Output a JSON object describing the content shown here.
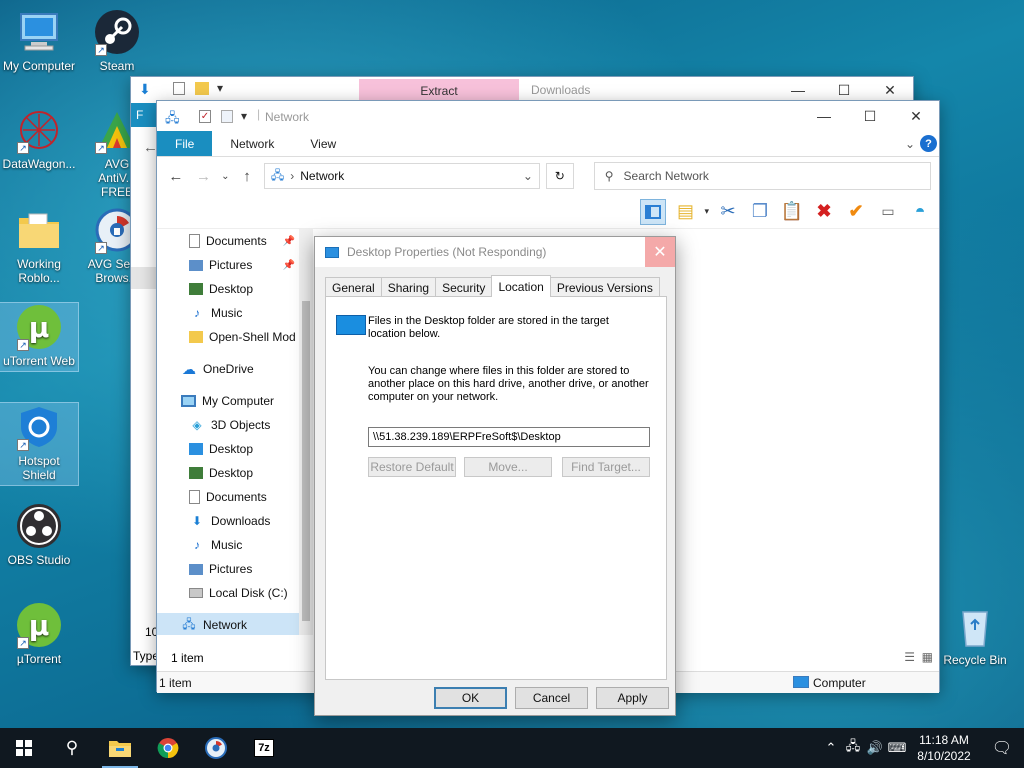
{
  "desktop": {
    "icons": [
      {
        "label": "My Computer"
      },
      {
        "label": "Steam"
      },
      {
        "label": "DataWagon..."
      },
      {
        "label": "AVG AntiV... FREE"
      },
      {
        "label": "Working Roblo..."
      },
      {
        "label": "AVG Sec... Brows..."
      },
      {
        "label": "uTorrent Web"
      },
      {
        "label": "Hotspot Shield"
      },
      {
        "label": "OBS Studio"
      },
      {
        "label": "µTorrent"
      },
      {
        "label": "Recycle Bin"
      }
    ]
  },
  "back_window": {
    "tab_label": "Extract",
    "title": "Downloads",
    "status_count": "10",
    "status_type": "Type"
  },
  "network_window": {
    "title": "Network",
    "ribbon_tabs": [
      "File",
      "Network",
      "View"
    ],
    "address": "Network",
    "search_placeholder": "Search Network",
    "nav_items": [
      {
        "label": "Documents",
        "icon": "documents-icon",
        "pinned": true
      },
      {
        "label": "Pictures",
        "icon": "pictures-icon",
        "pinned": true
      },
      {
        "label": "Desktop",
        "icon": "desktop-icon"
      },
      {
        "label": "Music",
        "icon": "music-icon"
      },
      {
        "label": "Open-Shell Mod",
        "icon": "folder-icon"
      },
      {
        "label": "OneDrive",
        "icon": "onedrive-icon"
      },
      {
        "label": "My Computer",
        "icon": "computer-icon"
      },
      {
        "label": "3D Objects",
        "icon": "3d-objects-icon"
      },
      {
        "label": "Desktop",
        "icon": "desktop-icon"
      },
      {
        "label": "Desktop",
        "icon": "desktop-icon"
      },
      {
        "label": "Documents",
        "icon": "documents-icon"
      },
      {
        "label": "Downloads",
        "icon": "downloads-icon"
      },
      {
        "label": "Music",
        "icon": "music-icon"
      },
      {
        "label": "Pictures",
        "icon": "pictures-icon"
      },
      {
        "label": "Local Disk (C:)",
        "icon": "disk-icon"
      },
      {
        "label": "Network",
        "icon": "network-icon",
        "selected": true
      }
    ],
    "pane_status": "1 item",
    "status_left": "1 item",
    "status_right": "Computer"
  },
  "dialog": {
    "title": "Desktop Properties (Not Responding)",
    "tabs": [
      "General",
      "Sharing",
      "Security",
      "Location",
      "Previous Versions"
    ],
    "active_tab": "Location",
    "intro_text": "Files in the Desktop folder are stored in the target location below.",
    "change_text": "You can change where files in this folder are stored to another place on this hard drive, another drive, or another computer on your network.",
    "path_value": "\\\\51.38.239.189\\ERPFreSoft$\\Desktop",
    "buttons": {
      "restore_default": "Restore Default",
      "move": "Move...",
      "find_target": "Find Target...",
      "ok": "OK",
      "cancel": "Cancel",
      "apply": "Apply"
    }
  },
  "taskbar": {
    "time": "11:18 AM",
    "date": "8/10/2022"
  }
}
